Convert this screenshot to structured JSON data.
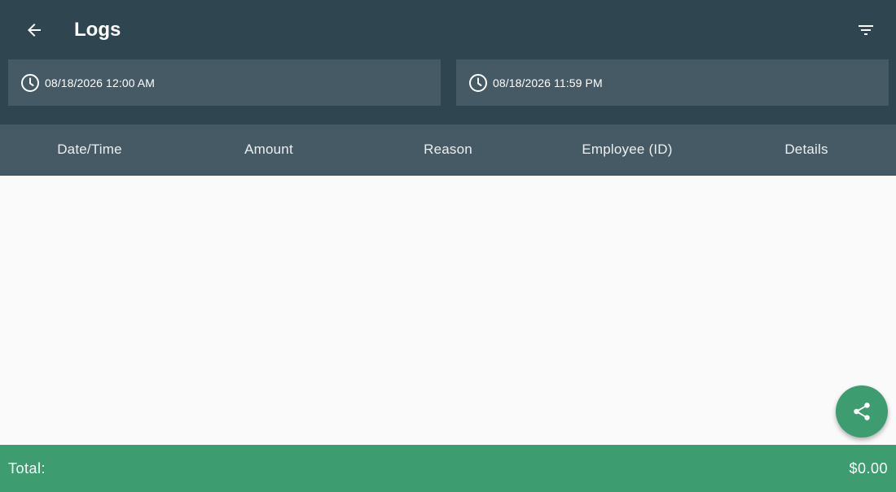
{
  "header": {
    "title": "Logs",
    "back_icon": "arrow-back-icon",
    "filter_icon": "filter-icon"
  },
  "date_range": {
    "start": "08/18/2026 12:00 AM",
    "end": "08/18/2026 11:59 PM",
    "icon": "clock-icon"
  },
  "table": {
    "columns": [
      "Date/Time",
      "Amount",
      "Reason",
      "Employee (ID)",
      "Details"
    ],
    "rows": []
  },
  "fab": {
    "icon": "share-icon"
  },
  "footer": {
    "total_label": "Total:",
    "total_value": "$0.00"
  },
  "colors": {
    "header_bg": "#2f4550",
    "field_bg": "#455a64",
    "accent": "#3d9c70",
    "content_bg": "#fafafa"
  }
}
